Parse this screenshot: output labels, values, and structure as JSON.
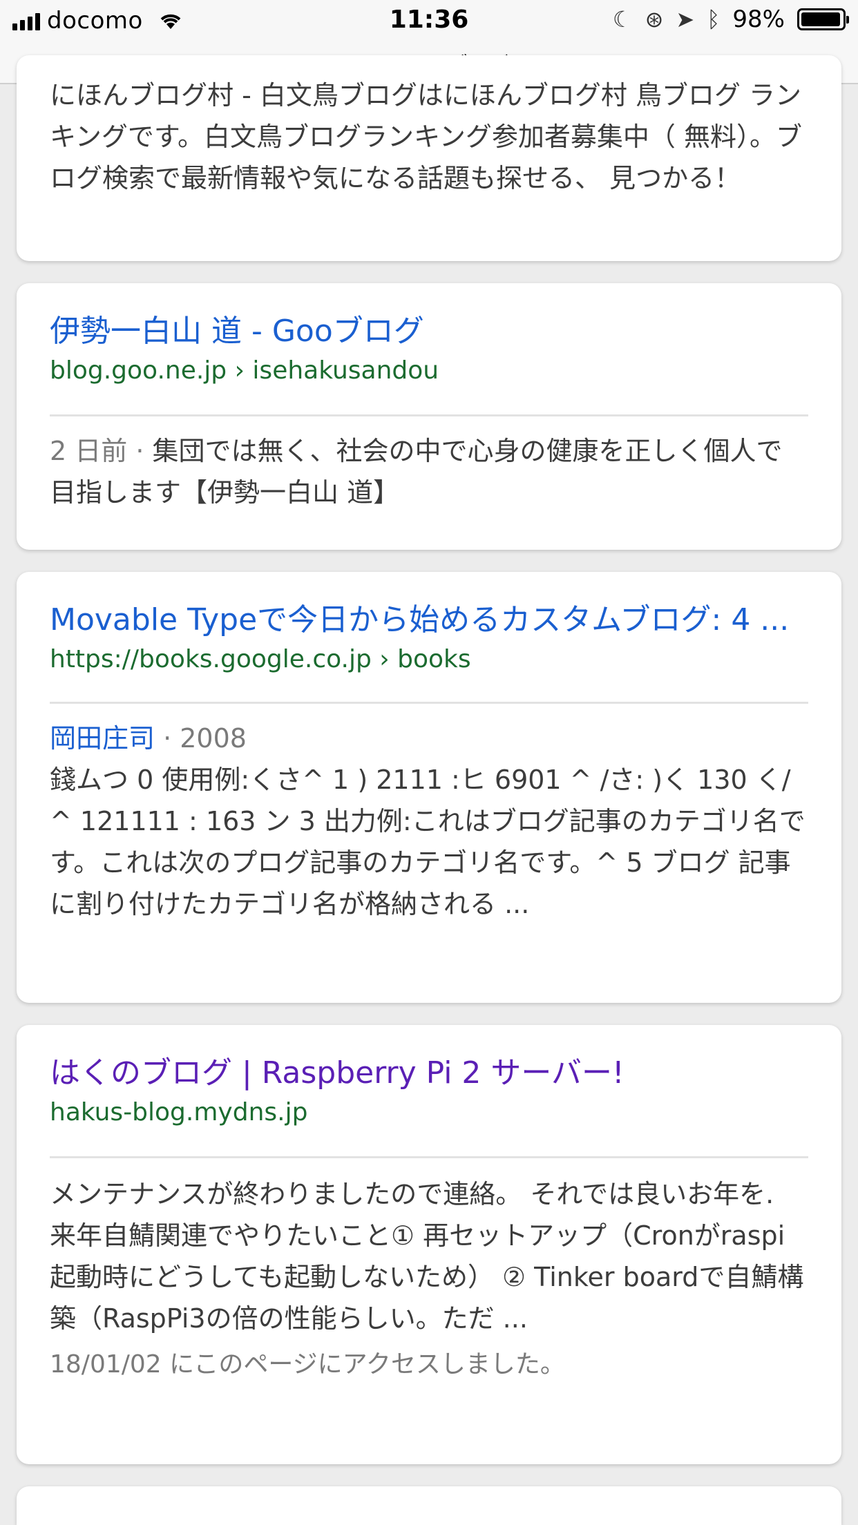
{
  "status_bar": {
    "carrier": "docomo",
    "time": "11:36",
    "battery_percent": "98%",
    "battery_level": 0.98
  },
  "url_bar": {
    "title": "はくのブログ"
  },
  "results": [
    {
      "snippet": "にほんブログ村 - 白文鳥ブログはにほんブログ村 鳥ブログ ランキングです。白文鳥ブログランキング参加者募集中（ 無料）。ブログ検索で最新情報や気になる話題も探せる、 見つかる！"
    },
    {
      "title": "伊勢一白山 道 - Gooブログ",
      "url": "blog.goo.ne.jp › isehakusandou",
      "date": "2 日前 · ",
      "snippet": "集団では無く、社会の中で心身の健康を正しく個人で目指します【伊勢一白山 道】"
    },
    {
      "title": "Movable Typeで今日から始めるカスタムブログ: 4 ...",
      "url": "https://books.google.co.jp › books",
      "author": "岡田庄司",
      "year": " · 2008",
      "snippet": "錢ムつ 0 使用例:くさ^ 1 ) 2111 :ヒ 6901 ^ /さ: )く 130 く/ ^ 121111 : 163 ン 3 出力例:これはブログ記事のカテゴリ名です。これは次のプログ記事のカテゴリ名です。^ 5 ブログ 記事に割り付けたカテゴリ名が格納される ..."
    },
    {
      "title": "はくのブログ | Raspberry Pi 2 サーバー!",
      "url": "hakus-blog.mydns.jp",
      "snippet": "メンテナンスが終わりましたので連絡。 それでは良いお年を. 来年自鯖関連でやりたいこと① 再セットアップ（Cronがraspi起動時にどうしても起動しないため） ② Tinker boardで自鯖構築（RaspPi3の倍の性能らしい。ただ ...",
      "visited_note": "18/01/02 にこのページにアクセスしました。"
    }
  ]
}
